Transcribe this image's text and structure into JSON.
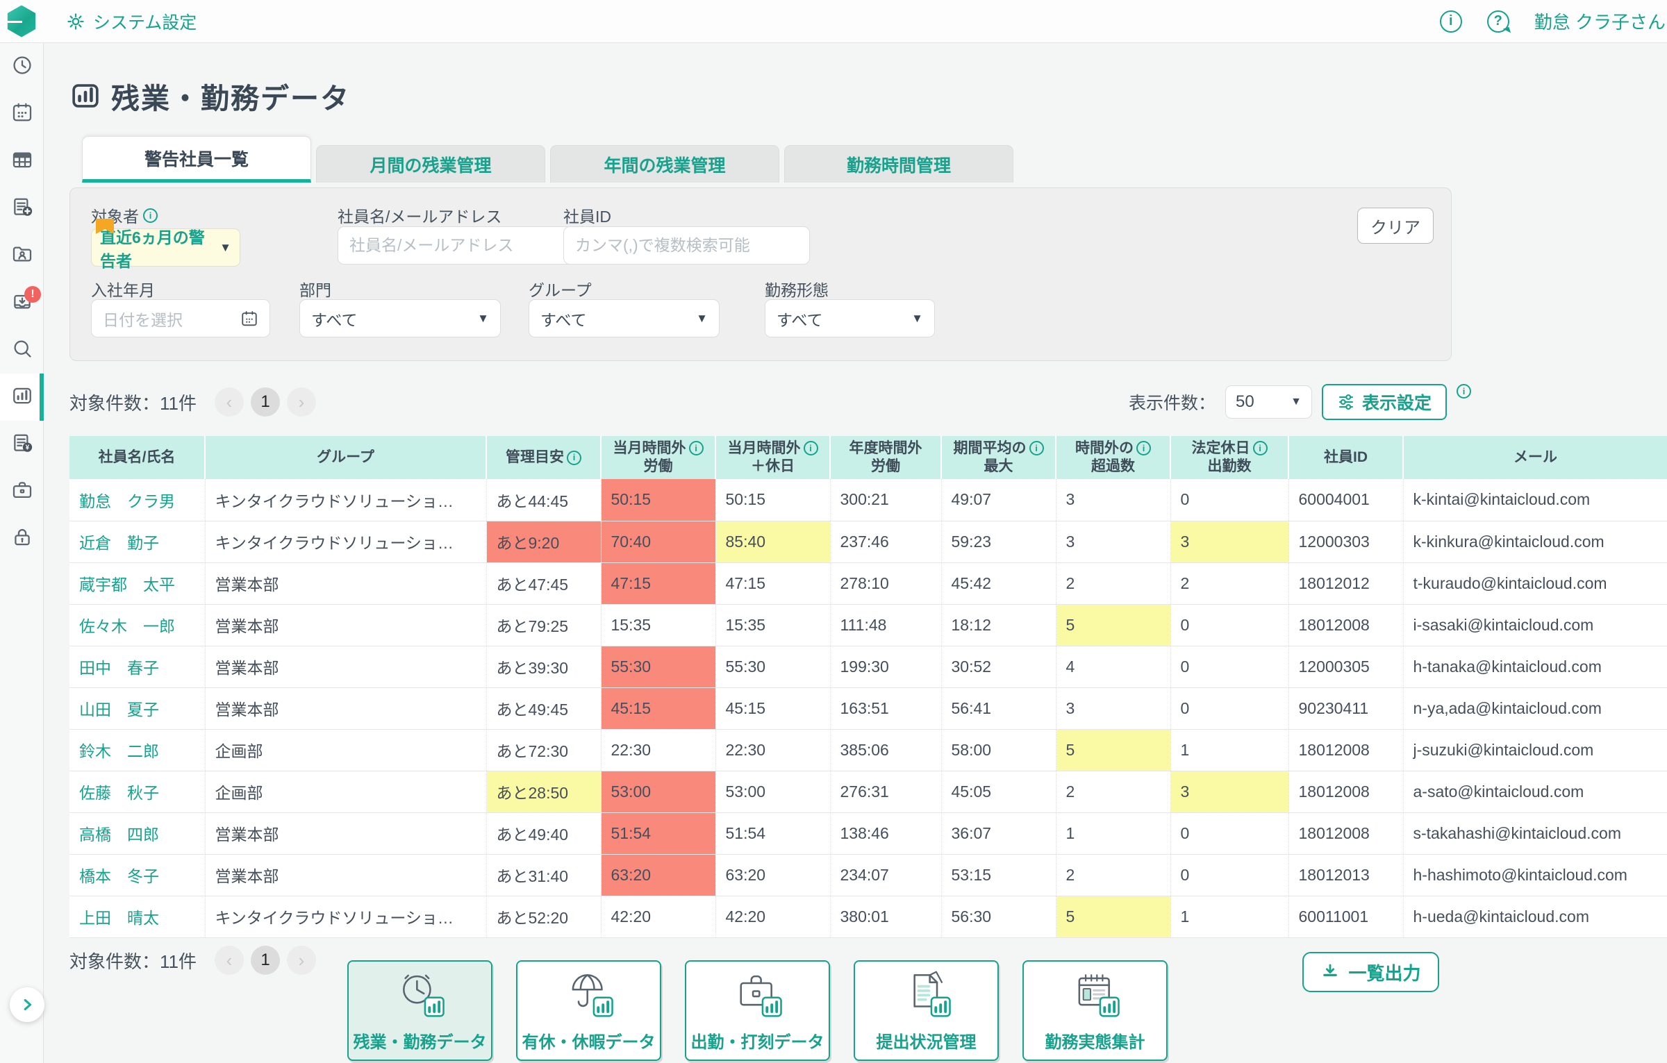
{
  "colors": {
    "accent_teal": "#17a28d",
    "active_bar_teal": "#17b09a",
    "table_header_bg": "#c9f0e8",
    "cell_red": "#f8897b",
    "cell_yellow": "#fafaa5",
    "alert_badge": "#f2635f",
    "bookmark_orange": "#f5a623"
  },
  "topbar": {
    "settings_label": "システム設定",
    "info_icon": "info-icon",
    "help_icon": "help-icon",
    "user_name": "勤怠 クラ子さん"
  },
  "sidebar": {
    "items": [
      {
        "icon": "clock-icon"
      },
      {
        "icon": "calendar-icon"
      },
      {
        "icon": "table-icon"
      },
      {
        "icon": "document-add-icon"
      },
      {
        "icon": "folder-user-icon"
      },
      {
        "icon": "inbox-download-icon",
        "badge": "!"
      },
      {
        "icon": "search-icon"
      },
      {
        "icon": "bar-chart-icon",
        "active": true
      },
      {
        "icon": "document-yen-icon"
      },
      {
        "icon": "briefcase-icon"
      },
      {
        "icon": "lock-icon"
      }
    ]
  },
  "page": {
    "title": "残業・勤務データ"
  },
  "tabs": [
    {
      "name": "warning-employee-list",
      "label": "警告社員一覧",
      "active": true
    },
    {
      "name": "monthly-overtime",
      "label": "月間の残業管理",
      "active": false
    },
    {
      "name": "yearly-overtime",
      "label": "年間の残業管理",
      "active": false
    },
    {
      "name": "working-hours",
      "label": "勤務時間管理",
      "active": false
    }
  ],
  "filters": {
    "target": {
      "label": "対象者",
      "value": "直近6ヵ月の警告者"
    },
    "name": {
      "label": "社員名/メールアドレス",
      "placeholder": "社員名/メールアドレス"
    },
    "employee_id": {
      "label": "社員ID",
      "placeholder": "カンマ(,)で複数検索可能"
    },
    "join_date": {
      "label": "入社年月",
      "placeholder": "日付を選択"
    },
    "department": {
      "label": "部門",
      "value": "すべて"
    },
    "group": {
      "label": "グループ",
      "value": "すべて"
    },
    "work_type": {
      "label": "勤務形態",
      "value": "すべて"
    },
    "clear_label": "クリア"
  },
  "list": {
    "count_label": "対象件数：11件",
    "page": "1",
    "prev": "‹",
    "next": "›",
    "per_page_label": "表示件数：",
    "per_page_value": "50",
    "display_settings_label": "表示設定",
    "export_label": "一覧出力"
  },
  "table": {
    "columns": [
      {
        "lines": [
          "社員名/氏名"
        ],
        "info": false
      },
      {
        "lines": [
          "グループ"
        ],
        "info": false
      },
      {
        "lines": [
          "管理目安"
        ],
        "info": true
      },
      {
        "lines": [
          "当月時間外",
          "労働"
        ],
        "info": true
      },
      {
        "lines": [
          "当月時間外",
          "＋休日"
        ],
        "info": true
      },
      {
        "lines": [
          "年度時間外",
          "労働"
        ],
        "info": false
      },
      {
        "lines": [
          "期間平均の",
          "最大"
        ],
        "info": true
      },
      {
        "lines": [
          "時間外の",
          "超過数"
        ],
        "info": true
      },
      {
        "lines": [
          "法定休日",
          "出勤数"
        ],
        "info": true
      },
      {
        "lines": [
          "社員ID"
        ],
        "info": false
      },
      {
        "lines": [
          "メール"
        ],
        "info": false
      }
    ],
    "rows": [
      {
        "name": "勤怠　クラ男",
        "cells": [
          [
            "キンタイクラウドソリューショ…",
            ""
          ],
          [
            "あと44:45",
            ""
          ],
          [
            "50:15",
            "red"
          ],
          [
            "50:15",
            ""
          ],
          [
            "300:21",
            ""
          ],
          [
            "49:07",
            ""
          ],
          [
            "3",
            ""
          ],
          [
            "0",
            ""
          ],
          [
            "60004001",
            ""
          ],
          [
            "k-kintai@kintaicloud.com",
            ""
          ]
        ]
      },
      {
        "name": "近倉　勤子",
        "cells": [
          [
            "キンタイクラウドソリューショ…",
            ""
          ],
          [
            "あと9:20",
            "red"
          ],
          [
            "70:40",
            "red"
          ],
          [
            "85:40",
            "yellow"
          ],
          [
            "237:46",
            ""
          ],
          [
            "59:23",
            ""
          ],
          [
            "3",
            ""
          ],
          [
            "3",
            "yellow"
          ],
          [
            "12000303",
            ""
          ],
          [
            "k-kinkura@kintaicloud.com",
            ""
          ]
        ]
      },
      {
        "name": "蔵宇都　太平",
        "cells": [
          [
            "営業本部",
            ""
          ],
          [
            "あと47:45",
            ""
          ],
          [
            "47:15",
            "red"
          ],
          [
            "47:15",
            ""
          ],
          [
            "278:10",
            ""
          ],
          [
            "45:42",
            ""
          ],
          [
            "2",
            ""
          ],
          [
            "2",
            ""
          ],
          [
            "18012012",
            ""
          ],
          [
            "t-kuraudo@kintaicloud.com",
            ""
          ]
        ]
      },
      {
        "name": "佐々木　一郎",
        "cells": [
          [
            "営業本部",
            ""
          ],
          [
            "あと79:25",
            ""
          ],
          [
            "15:35",
            ""
          ],
          [
            "15:35",
            ""
          ],
          [
            "111:48",
            ""
          ],
          [
            "18:12",
            ""
          ],
          [
            "5",
            "yellow"
          ],
          [
            "0",
            ""
          ],
          [
            "18012008",
            ""
          ],
          [
            "i-sasaki@kintaicloud.com",
            ""
          ]
        ]
      },
      {
        "name": "田中　春子",
        "cells": [
          [
            "営業本部",
            ""
          ],
          [
            "あと39:30",
            ""
          ],
          [
            "55:30",
            "red"
          ],
          [
            "55:30",
            ""
          ],
          [
            "199:30",
            ""
          ],
          [
            "30:52",
            ""
          ],
          [
            "4",
            ""
          ],
          [
            "0",
            ""
          ],
          [
            "12000305",
            ""
          ],
          [
            "h-tanaka@kintaicloud.com",
            ""
          ]
        ]
      },
      {
        "name": "山田　夏子",
        "cells": [
          [
            "営業本部",
            ""
          ],
          [
            "あと49:45",
            ""
          ],
          [
            "45:15",
            "red"
          ],
          [
            "45:15",
            ""
          ],
          [
            "163:51",
            ""
          ],
          [
            "56:41",
            ""
          ],
          [
            "3",
            ""
          ],
          [
            "0",
            ""
          ],
          [
            "90230411",
            ""
          ],
          [
            "n-ya,ada@kintaicloud.com",
            ""
          ]
        ]
      },
      {
        "name": "鈴木　二郎",
        "cells": [
          [
            "企画部",
            ""
          ],
          [
            "あと72:30",
            ""
          ],
          [
            "22:30",
            ""
          ],
          [
            "22:30",
            ""
          ],
          [
            "385:06",
            ""
          ],
          [
            "58:00",
            ""
          ],
          [
            "5",
            "yellow"
          ],
          [
            "1",
            ""
          ],
          [
            "18012008",
            ""
          ],
          [
            "j-suzuki@kintaicloud.com",
            ""
          ]
        ]
      },
      {
        "name": "佐藤　秋子",
        "cells": [
          [
            "企画部",
            ""
          ],
          [
            "あと28:50",
            "yellow"
          ],
          [
            "53:00",
            "red"
          ],
          [
            "53:00",
            ""
          ],
          [
            "276:31",
            ""
          ],
          [
            "45:05",
            ""
          ],
          [
            "2",
            ""
          ],
          [
            "3",
            "yellow"
          ],
          [
            "18012008",
            ""
          ],
          [
            "a-sato@kintaicloud.com",
            ""
          ]
        ]
      },
      {
        "name": "高橋　四郎",
        "cells": [
          [
            "営業本部",
            ""
          ],
          [
            "あと49:40",
            ""
          ],
          [
            "51:54",
            "red"
          ],
          [
            "51:54",
            ""
          ],
          [
            "138:46",
            ""
          ],
          [
            "36:07",
            ""
          ],
          [
            "1",
            ""
          ],
          [
            "0",
            ""
          ],
          [
            "18012008",
            ""
          ],
          [
            "s-takahashi@kintaicloud.com",
            ""
          ]
        ]
      },
      {
        "name": "橋本　冬子",
        "cells": [
          [
            "営業本部",
            ""
          ],
          [
            "あと31:40",
            ""
          ],
          [
            "63:20",
            "red"
          ],
          [
            "63:20",
            ""
          ],
          [
            "234:07",
            ""
          ],
          [
            "53:15",
            ""
          ],
          [
            "2",
            ""
          ],
          [
            "0",
            ""
          ],
          [
            "18012013",
            ""
          ],
          [
            "h-hashimoto@kintaicloud.com",
            ""
          ]
        ]
      },
      {
        "name": "上田　晴太",
        "cells": [
          [
            "キンタイクラウドソリューショ…",
            ""
          ],
          [
            "あと52:20",
            ""
          ],
          [
            "42:20",
            ""
          ],
          [
            "42:20",
            ""
          ],
          [
            "380:01",
            ""
          ],
          [
            "56:30",
            ""
          ],
          [
            "5",
            "yellow"
          ],
          [
            "1",
            ""
          ],
          [
            "60011001",
            ""
          ],
          [
            "h-ueda@kintaicloud.com",
            ""
          ]
        ]
      }
    ]
  },
  "bottom_nav": [
    {
      "icon": "clock-chart-icon",
      "label": "残業・勤務データ",
      "active": true
    },
    {
      "icon": "umbrella-chart-icon",
      "label": "有休・休暇データ",
      "active": false
    },
    {
      "icon": "briefcase-chart-icon",
      "label": "出勤・打刻データ",
      "active": false
    },
    {
      "icon": "docs-chart-icon",
      "label": "提出状況管理",
      "active": false
    },
    {
      "icon": "calendar-chart-icon",
      "label": "勤務実態集計",
      "active": false
    }
  ]
}
